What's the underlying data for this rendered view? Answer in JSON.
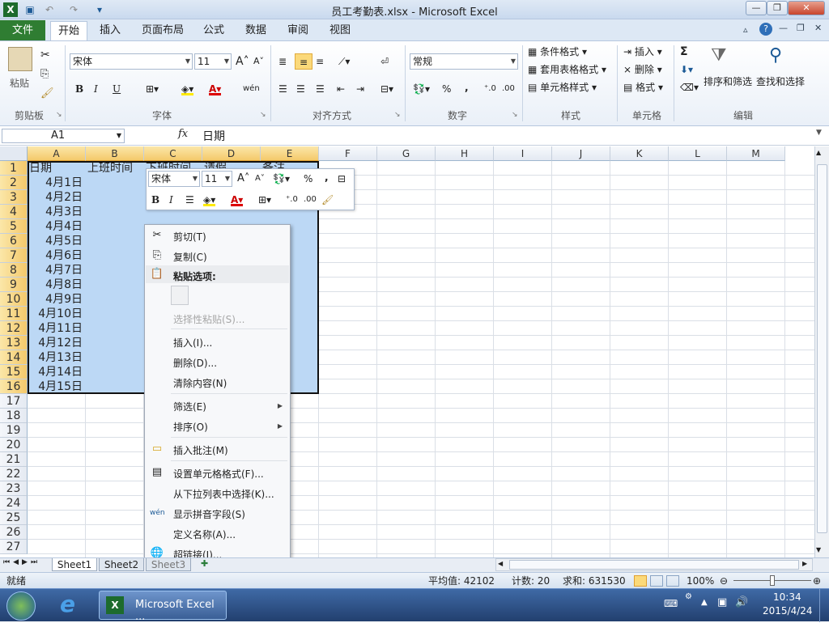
{
  "window": {
    "title": "员工考勤表.xlsx - Microsoft Excel"
  },
  "ribbon_tabs": [
    "文件",
    "开始",
    "插入",
    "页面布局",
    "公式",
    "数据",
    "审阅",
    "视图"
  ],
  "clipboard": {
    "paste": "粘贴",
    "label": "剪贴板"
  },
  "font": {
    "name": "宋体",
    "size": "11",
    "label": "字体",
    "bold": "B",
    "italic": "I",
    "underline": "U",
    "phonetic": "wén"
  },
  "alignment": {
    "label": "对齐方式"
  },
  "number": {
    "format": "常规",
    "percent": "%",
    "comma": ",",
    "inc_decimal": "←.0\n.00",
    "label": "数字"
  },
  "styles": {
    "conditional": "条件格式",
    "table": "套用表格格式",
    "cell": "单元格样式",
    "label": "样式"
  },
  "cells": {
    "insert": "插入",
    "delete": "删除",
    "format": "格式",
    "label": "单元格"
  },
  "editing": {
    "sum": "Σ",
    "sort": "排序和筛选",
    "find": "查找和选择",
    "label": "编辑"
  },
  "formula_bar": {
    "name_box": "A1",
    "fx": "fx",
    "content": "日期"
  },
  "columns": [
    "A",
    "B",
    "C",
    "D",
    "E",
    "F",
    "G",
    "H",
    "I",
    "J",
    "K",
    "L",
    "M"
  ],
  "rows": [
    "1",
    "2",
    "3",
    "4",
    "5",
    "6",
    "7",
    "8",
    "9",
    "10",
    "11",
    "12",
    "13",
    "14",
    "15",
    "16",
    "17",
    "18",
    "19",
    "20",
    "21",
    "22",
    "23",
    "24",
    "25",
    "26",
    "27"
  ],
  "sheet": {
    "headers": [
      "日期",
      "上班时间",
      "下班时间",
      "请假",
      "备注"
    ],
    "dates": [
      "4月1日",
      "4月2日",
      "4月3日",
      "4月4日",
      "4月5日",
      "4月6日",
      "4月7日",
      "4月8日",
      "4月9日",
      "4月10日",
      "4月11日",
      "4月12日",
      "4月13日",
      "4月14日",
      "4月15日"
    ]
  },
  "mini_toolbar": {
    "font": "宋体",
    "size": "11",
    "bold": "B",
    "italic": "I",
    "percent": "%",
    "comma": ","
  },
  "context_menu": {
    "cut": "剪切(T)",
    "copy": "复制(C)",
    "paste_options": "粘贴选项:",
    "paste_special": "选择性粘贴(S)...",
    "insert": "插入(I)...",
    "delete": "删除(D)...",
    "clear": "清除内容(N)",
    "filter": "筛选(E)",
    "sort": "排序(O)",
    "insert_comment": "插入批注(M)",
    "format_cells": "设置单元格格式(F)...",
    "pick_list": "从下拉列表中选择(K)...",
    "phonetic": "显示拼音字段(S)",
    "define_name": "定义名称(A)...",
    "hyperlink": "超链接(I)..."
  },
  "sheet_tabs": [
    "Sheet1",
    "Sheet2",
    "Sheet3"
  ],
  "status": {
    "ready": "就绪",
    "average": "平均值: 42102",
    "count": "计数: 20",
    "sum": "求和: 631530",
    "zoom": "100%"
  },
  "taskbar": {
    "app": "Microsoft Excel ...",
    "time": "10:34",
    "date": "2015/4/24"
  }
}
